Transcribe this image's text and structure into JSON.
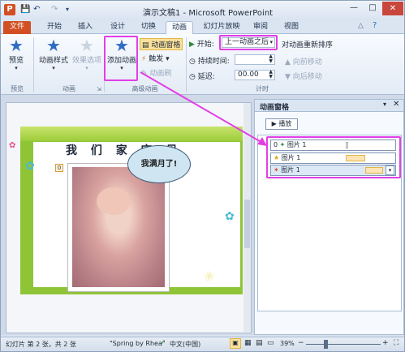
{
  "window": {
    "title": "演示文稿1 - Microsoft PowerPoint",
    "min_label": "—",
    "max_label": "□",
    "close_label": "✕",
    "app_badge": "P"
  },
  "tabs": [
    "文件",
    "开始",
    "插入",
    "设计",
    "切换",
    "动画",
    "幻灯片放映",
    "审阅",
    "视图"
  ],
  "ribbon": {
    "preview": {
      "label": "预览",
      "group": "预览"
    },
    "animation": {
      "style_label": "动画样式",
      "effect_label": "效果选项",
      "group": "动画"
    },
    "advanced": {
      "add_label": "添加动画",
      "pane_label": "动画窗格",
      "trigger_label": "触发",
      "painter_label": "动画刷",
      "group": "高级动画"
    },
    "timing": {
      "start_label": "开始:",
      "start_value": "上一动画之后",
      "duration_label": "持续时间:",
      "delay_label": "延迟:",
      "delay_value": "00.00",
      "reorder_label": "对动画重新排序",
      "move_earlier": "向前移动",
      "move_later": "向后移动",
      "group": "计时"
    }
  },
  "slide": {
    "title": "我 们 家 宝 贝",
    "bubble_text": "我满月了!",
    "anim_tag": "0"
  },
  "anim_pane": {
    "title": "动画窗格",
    "play_label": "播放",
    "items": [
      {
        "index": "0",
        "label": "图片 1"
      },
      {
        "index": "",
        "label": "图片 1"
      },
      {
        "index": "",
        "label": "图片 1"
      }
    ]
  },
  "status": {
    "slide_info": "幻灯片 第 2 张，共 2 张",
    "theme": "\"Spring by Rhea\"",
    "language": "中文(中国)",
    "zoom": "39%"
  },
  "colors": {
    "highlight": "#e23ee6",
    "file_tab": "#d24f24",
    "slide_green": "#8fc437"
  }
}
